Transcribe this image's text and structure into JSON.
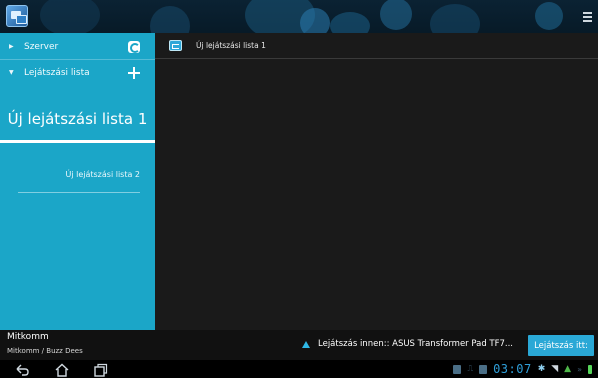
{
  "actionbar": {
    "app_icon": "media-server-icon",
    "menu_icon": "overflow-menu-icon"
  },
  "sidebar": {
    "items": [
      {
        "label": "Szerver",
        "expanded": false,
        "action_icon": "refresh-icon"
      },
      {
        "label": "Lejátszási lista",
        "expanded": true,
        "action_icon": "plus-icon"
      }
    ],
    "playlists": [
      {
        "label": "Új lejátszási lista 1",
        "selected": true
      },
      {
        "label": "Új lejátszási lista 2",
        "selected": false
      }
    ]
  },
  "content": {
    "header_icon": "playlist-icon",
    "header_title": "Új lejátszási lista 1"
  },
  "infobar": {
    "now_title": "Mitkomm",
    "now_subtitle": "Mitkomm / Buzz Dees",
    "play_from": "Lejátszás innen:: ASUS Transformer Pad TF7...",
    "play_here_label": "Lejátszás itt:"
  },
  "statusbar": {
    "clock": "03:07"
  },
  "colors": {
    "accent": "#1ba6c8",
    "button": "#2aa8d6",
    "clock": "#2f9fd9",
    "content_bg": "#1a1a1a"
  }
}
